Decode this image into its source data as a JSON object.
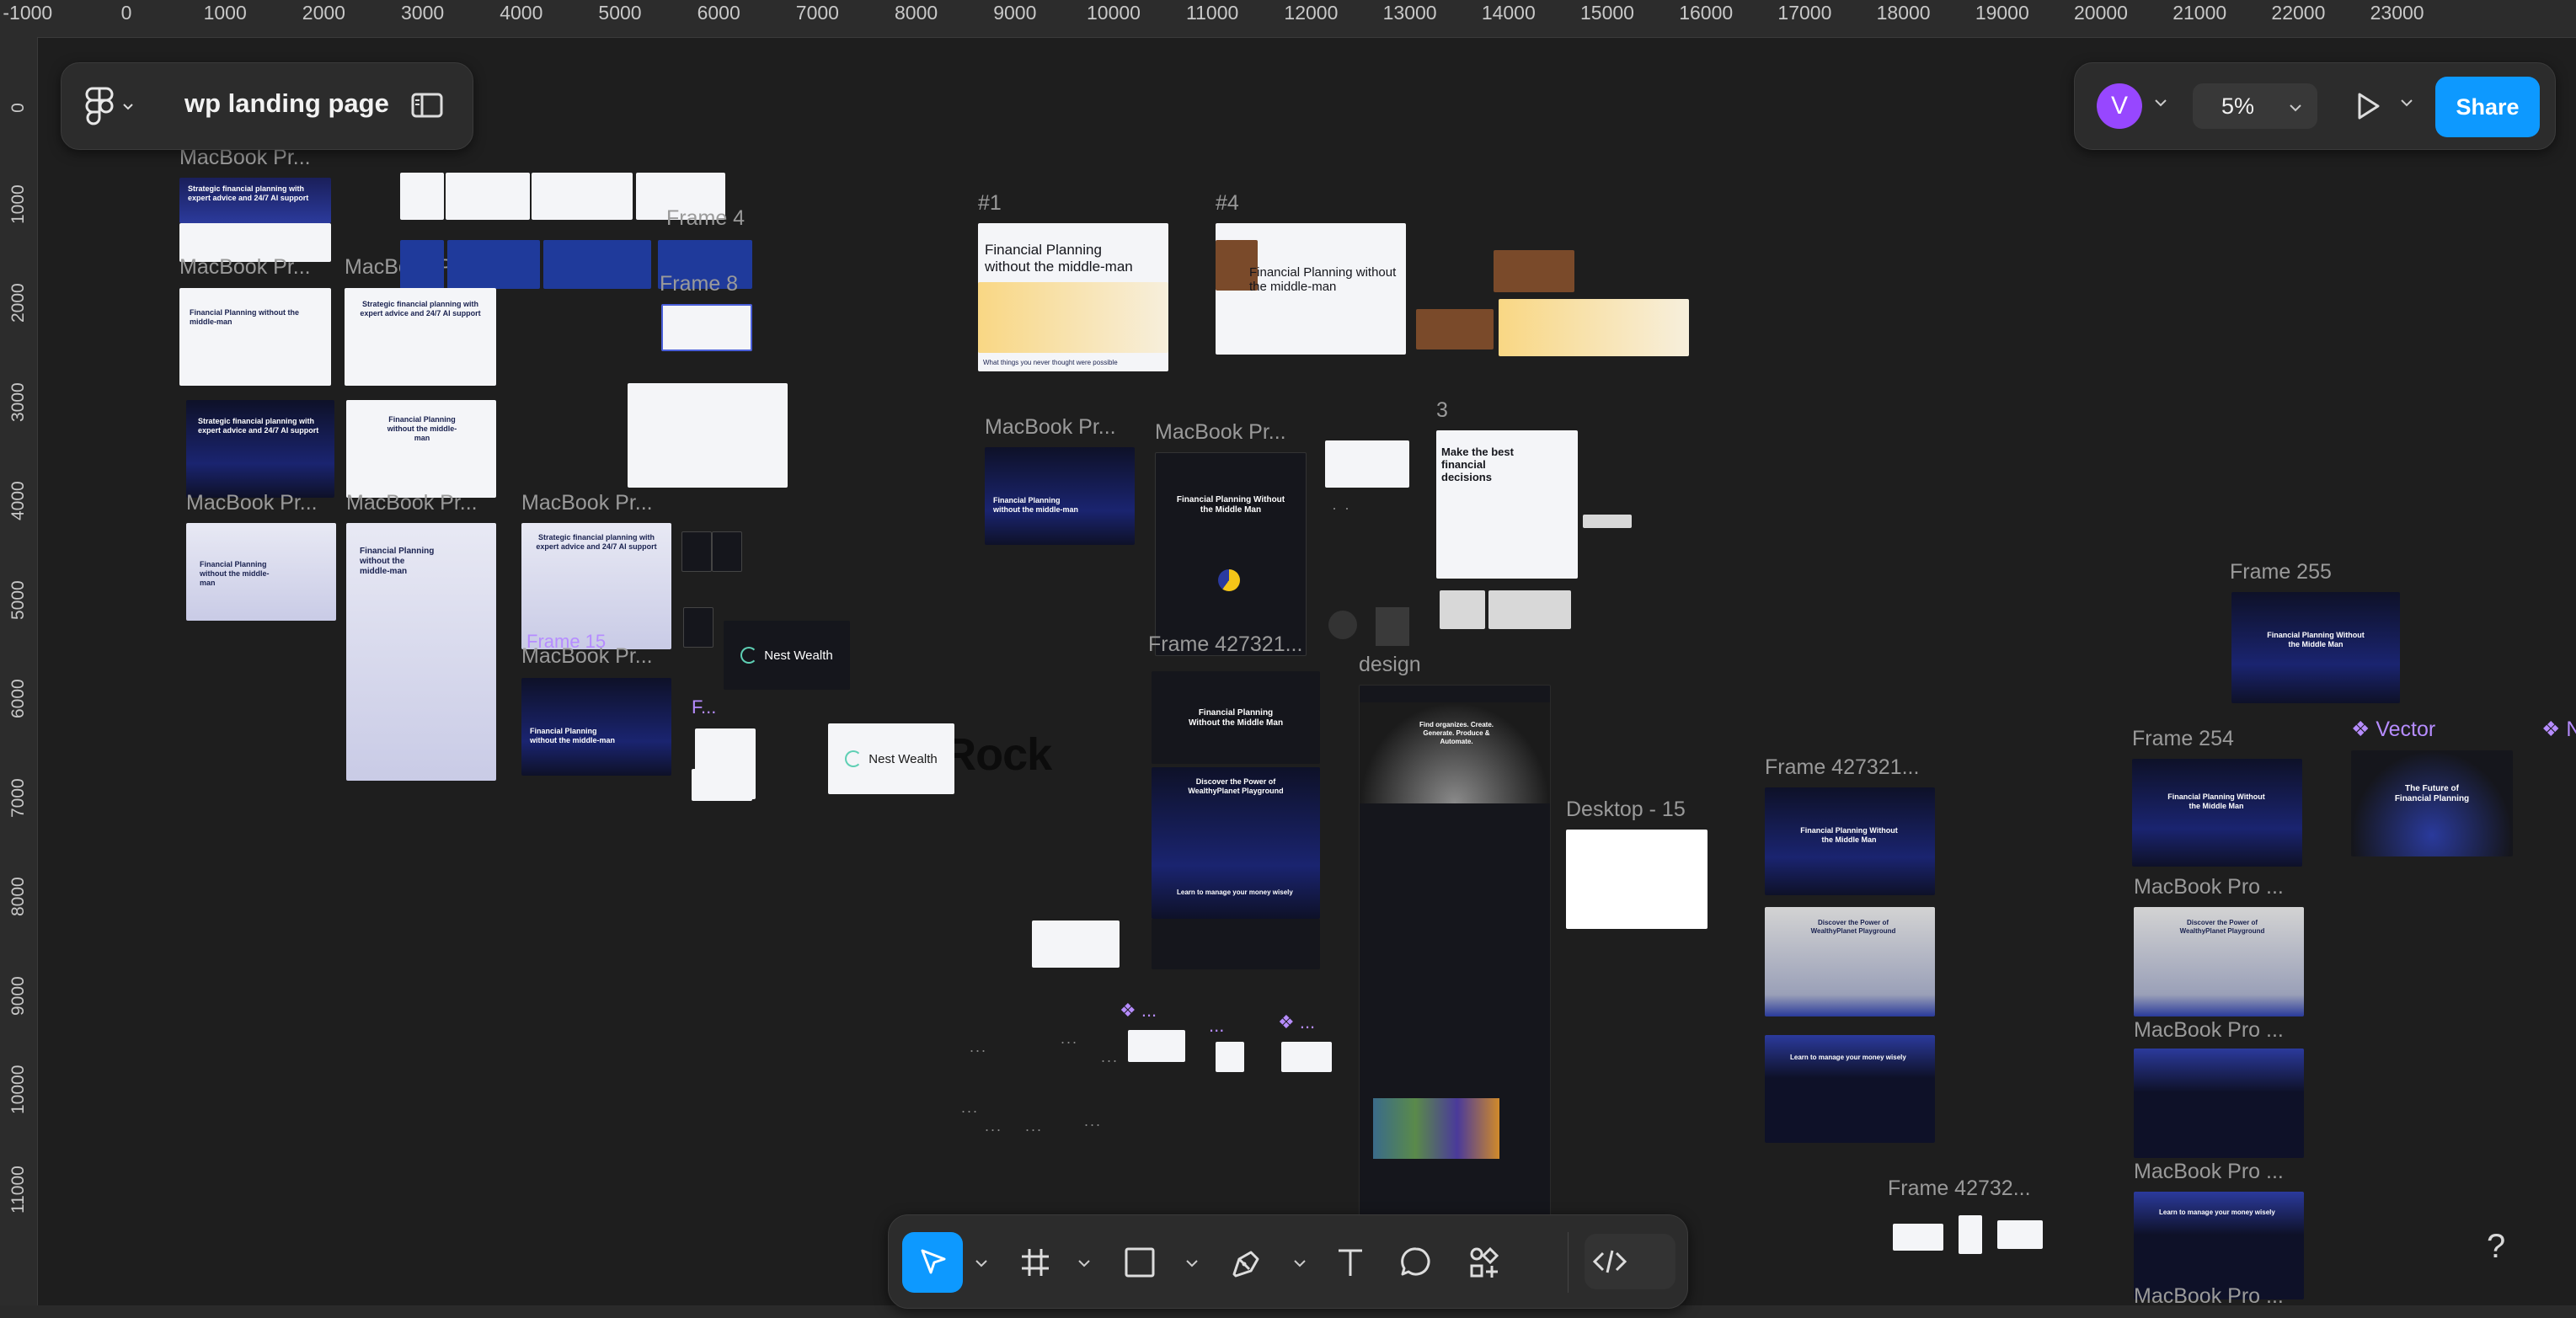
{
  "ruler": {
    "x_ticks": [
      "-1000",
      "0",
      "1000",
      "2000",
      "3000",
      "4000",
      "5000",
      "6000",
      "7000",
      "8000",
      "9000",
      "10000",
      "11000",
      "12000",
      "13000",
      "14000",
      "15000",
      "16000",
      "17000",
      "18000",
      "19000",
      "20000",
      "21000",
      "22000",
      "23000"
    ],
    "y_ticks": [
      "0",
      "1000",
      "2000",
      "3000",
      "4000",
      "5000",
      "6000",
      "7000",
      "8000",
      "9000",
      "10000",
      "11000"
    ]
  },
  "file": {
    "name": "wp landing page"
  },
  "header": {
    "avatar_initial": "V",
    "zoom": "5%",
    "share_label": "Share"
  },
  "help": "?",
  "toolbar": {
    "tools": [
      "move-tool",
      "frame-tool",
      "shape-tool",
      "pen-tool",
      "text-tool",
      "comment-tool",
      "actions-tool"
    ],
    "active": "move-tool",
    "dev_mode": "dev-mode-toggle"
  },
  "canvas": {
    "labels": {
      "mbp1": "MacBook Pr...",
      "mbp2": "MacBook Pr...",
      "mbp3": "MacBook Pr...",
      "mbp4": "MacBook Pr...",
      "mbp5": "MacBook Pr...",
      "mbp6": "MacBook Pr...",
      "mbp7": "MacBook Pr...",
      "mbp8": "MacBook Pr...",
      "mbp9": "MacBook Pr...",
      "frame4": "Frame 4",
      "frame8": "Frame 8",
      "frame15": "Frame 15",
      "f_comp": "F...",
      "h1": "#1",
      "h4": "#4",
      "three": "3",
      "frame427_a": "Frame 427321...",
      "design": "design",
      "desktop15": "Desktop - 15",
      "frame427_b": "Frame 427321...",
      "frame255": "Frame 255",
      "frame254": "Frame 254",
      "vector": "Vector",
      "mbp_pro1": "MacBook Pro ...",
      "mbp_pro2": "MacBook Pro ...",
      "mbp_pro3": "MacBook Pro ...",
      "mbp_pro4": "MacBook Pro ...",
      "frame427_c": "Frame 42732...",
      "blackrock": "BlackRock",
      "nest1": "Nest Wealth",
      "nest2": "Nest Wealth"
    },
    "thumb_text": {
      "fp_middle": "Financial Planning without the middle-man",
      "fp_middle_b": "Financial Planning without the middle-man",
      "strategic": "Strategic financial planning with expert advice and 24/7 AI support",
      "fp_mm": "Financial Planning Without the Middle Man",
      "discover": "Discover the Power of WealthyPlanet Playground",
      "learn": "Learn to manage your money wisely",
      "best": "Make the best financial decisions",
      "future": "The Future of Financial Planning",
      "fin_org": "Find organizes. Create. Generate. Produce & Automate.",
      "fp_short": "Financial Planning without the middle-man",
      "things": "What things you never thought were possible"
    }
  }
}
